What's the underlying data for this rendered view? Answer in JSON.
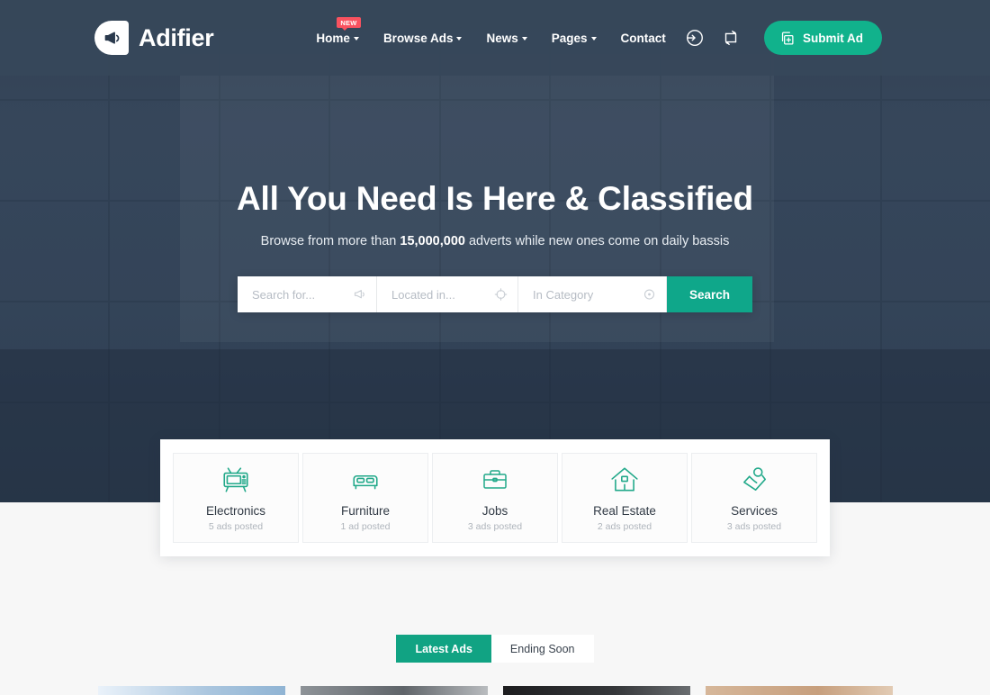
{
  "brand": {
    "name": "Adifier",
    "logo_icon": "megaphone-icon"
  },
  "nav": {
    "items": [
      {
        "label": "Home",
        "has_dropdown": true,
        "badge": "NEW"
      },
      {
        "label": "Browse Ads",
        "has_dropdown": true,
        "badge": ""
      },
      {
        "label": "News",
        "has_dropdown": true,
        "badge": ""
      },
      {
        "label": "Pages",
        "has_dropdown": true,
        "badge": ""
      },
      {
        "label": "Contact",
        "has_dropdown": false,
        "badge": ""
      }
    ]
  },
  "header_actions": {
    "login_icon": "sign-in-icon",
    "compare_icon": "compare-arrows-icon",
    "submit_label": "Submit Ad",
    "submit_icon": "duplicate-plus-icon"
  },
  "hero": {
    "title": "All You Need Is Here & Classified",
    "subtitle_before": "Browse from more than ",
    "subtitle_highlight": "15,000,000",
    "subtitle_after": " adverts while new ones come on daily bassis"
  },
  "search": {
    "keyword_placeholder": "Search for...",
    "keyword_value": "",
    "keyword_icon": "megaphone-icon",
    "location_placeholder": "Located in...",
    "location_value": "",
    "location_icon": "crosshair-icon",
    "category_placeholder": "In Category",
    "category_value": "",
    "category_icon": "circle-dot-icon",
    "button_label": "Search"
  },
  "categories": [
    {
      "name": "Electronics",
      "count": "5 ads posted",
      "icon": "tv-icon"
    },
    {
      "name": "Furniture",
      "count": "1 ad posted",
      "icon": "bed-icon"
    },
    {
      "name": "Jobs",
      "count": "3 ads posted",
      "icon": "briefcase-icon"
    },
    {
      "name": "Real Estate",
      "count": "2 ads posted",
      "icon": "house-icon"
    },
    {
      "name": "Services",
      "count": "3 ads posted",
      "icon": "handshake-icon"
    }
  ],
  "listing_tabs": [
    {
      "label": "Latest Ads",
      "active": true
    },
    {
      "label": "Ending Soon",
      "active": false
    }
  ],
  "colors": {
    "accent_green": "#11b28c",
    "search_green": "#0fa78a",
    "tab_green": "#11a383",
    "badge_red": "#f9525f",
    "header_slate": "#37475a",
    "page_bg": "#f7f7f7"
  }
}
